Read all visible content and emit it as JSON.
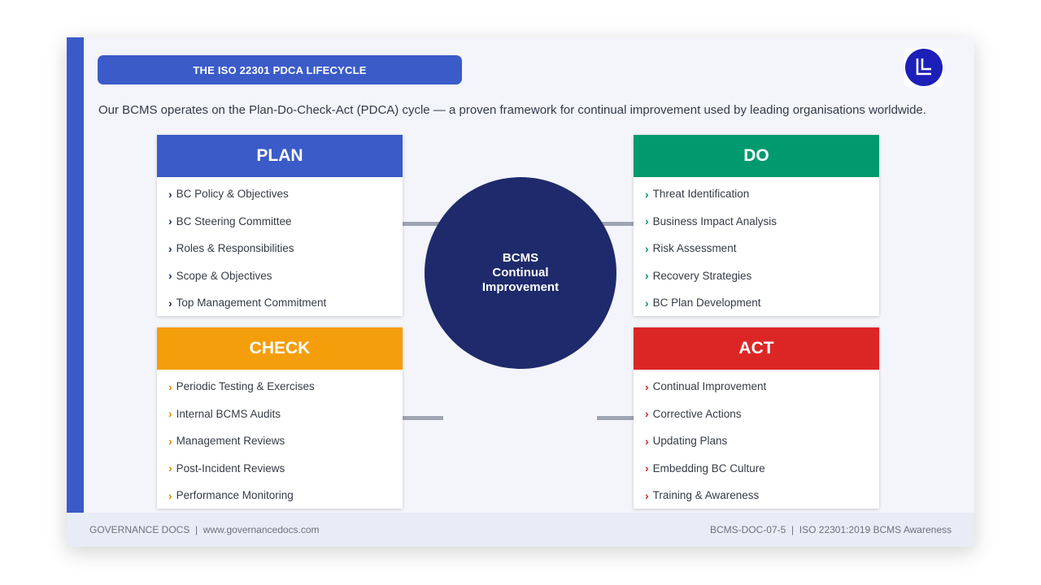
{
  "header": {
    "title": "THE ISO 22301 PDCA LIFECYCLE",
    "intro": "Our BCMS operates on the Plan-Do-Check-Act (PDCA) cycle — a proven framework for continual improvement used by leading organisations worldwide."
  },
  "colors": {
    "accent": "#3b5bc9",
    "plan": "#3b5bc9",
    "do": "#009a6e",
    "check": "#f59e0b",
    "act": "#dc2626",
    "center": "#1e2a6b"
  },
  "center": {
    "line1": "BCMS",
    "line2": "Continual",
    "line3": "Improvement"
  },
  "phases": {
    "plan": {
      "title": "PLAN",
      "items": [
        "BC Policy & Objectives",
        "BC Steering Committee",
        "Roles & Responsibilities",
        "Scope & Objectives",
        "Top Management Commitment"
      ]
    },
    "do": {
      "title": "DO",
      "items": [
        "Threat Identification",
        "Business Impact Analysis",
        "Risk Assessment",
        "Recovery Strategies",
        "BC Plan Development"
      ]
    },
    "check": {
      "title": "CHECK",
      "items": [
        "Periodic Testing & Exercises",
        "Internal BCMS Audits",
        "Management Reviews",
        "Post-Incident Reviews",
        "Performance Monitoring"
      ]
    },
    "act": {
      "title": "ACT",
      "items": [
        "Continual Improvement",
        "Corrective Actions",
        "Updating Plans",
        "Embedding BC Culture",
        "Training & Awareness"
      ]
    }
  },
  "bullet": "›",
  "footer": {
    "left": "GOVERNANCE DOCS  |  www.governancedocs.com",
    "right": "BCMS-DOC-07-5  |  ISO 22301:2019 BCMS Awareness"
  },
  "icons": {
    "logo": "ll-logo-icon"
  }
}
